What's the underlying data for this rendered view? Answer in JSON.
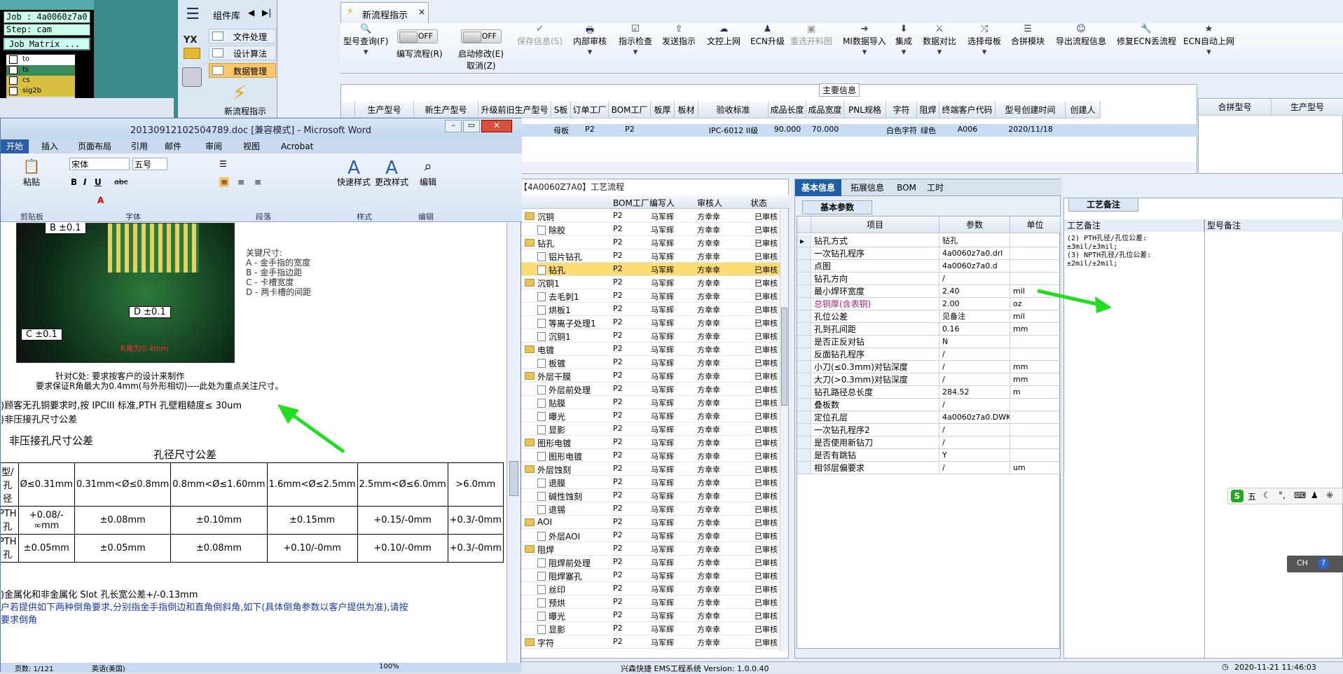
{
  "console": {
    "job": "Job : 4a0060z7a0",
    "step": "Step: cam",
    "matrix": "Job Matrix ...",
    "layers": [
      "to",
      "ts",
      "cs",
      "sig2b"
    ]
  },
  "nav": {
    "title": "组件库",
    "logo": "YX",
    "items": [
      "文件处理",
      "设计算法",
      "数据管理"
    ],
    "active": 2,
    "bottom": "新流程指示"
  },
  "tab": {
    "title": "新流程指示",
    "close": "×"
  },
  "toolbar": {
    "items": [
      "型号查询(F)",
      "编写流程(R)",
      "启动修改(E)",
      "保存信息(S)",
      "内部审核",
      "指示检查",
      "发送指示",
      "文控上网",
      "ECN升级",
      "重选开料图",
      "MI数据导入",
      "集成",
      "数据对比",
      "选择母板",
      "合拼模块",
      "导出流程信息",
      "修复ECN丢流程",
      "ECN自动上网"
    ],
    "cancel": "取消(Z)",
    "toggle_off": "OFF"
  },
  "main_info": {
    "title": "主要信息",
    "columns": [
      "生产型号",
      "新生产型号",
      "升级前旧生产型号",
      "S板",
      "订单工厂",
      "BOM工厂",
      "板厚",
      "板材",
      "验收标准",
      "成品长度",
      "成品宽度",
      "PNL规格",
      "字符",
      "阻焊",
      "终端客户代码",
      "型号创建时间",
      "创建人"
    ],
    "row": [
      "",
      "",
      "",
      "母板",
      "P2",
      "P2",
      "",
      "",
      "IPC-6012 II级",
      "90.000",
      "70.000",
      "",
      "白色字符",
      "绿色",
      "A006",
      "2020/11/18",
      ""
    ],
    "side_columns": [
      "合拼型号",
      "生产型号"
    ]
  },
  "word": {
    "title": "20130912102504789.doc [兼容模式] - Microsoft Word",
    "tabs": [
      "开始",
      "插入",
      "页面布局",
      "引用",
      "邮件",
      "审阅",
      "视图",
      "Acrobat"
    ],
    "font": "宋体",
    "size": "五号",
    "groups": [
      "剪贴板",
      "字体",
      "段落",
      "样式",
      "编辑"
    ],
    "big_buttons": [
      "粘贴",
      "快速样式",
      "更改样式",
      "编辑"
    ],
    "diagram_labels": [
      "B ±0.1",
      "D ±0.1",
      "C ±0.1",
      "R角为0.4mm"
    ],
    "key_dims": [
      "关键尺寸:",
      "A - 金手指的宽度",
      "B - 金手指边距",
      "C - 卡槽宽度",
      "D - 两卡槽的间距"
    ],
    "caption1": "针对C处: 要求按客户的设计来制作",
    "caption2": "要求保证R角最大为0.4mm(与外形相切)----此处为重点关注尺寸。",
    "line1": ")顾客无孔铜要求时,按 IPCIII 标准,PTH 孔壁粗糙度≤ 30um",
    "line2": ")非压接孔尺寸公差",
    "heading": "非压接孔尺寸公差",
    "table_title": "孔径尺寸公差",
    "table": [
      [
        "型/孔径",
        "Ø≤0.31mm",
        "0.31mm<Ø≤0.8mm",
        "0.8mm<Ø≤1.60mm",
        "1.6mm<Ø≤2.5mm",
        "2.5mm<Ø≤6.0mm",
        ">6.0mm"
      ],
      [
        "PTH孔",
        "+0.08/-∞mm",
        "±0.08mm",
        "±0.10mm",
        "±0.15mm",
        "+0.15/-0mm",
        "+0.3/-0mm"
      ],
      [
        "PTH孔",
        "±0.05mm",
        "±0.05mm",
        "±0.08mm",
        "+0.10/-0mm",
        "+0.10/-0mm",
        "+0.3/-0mm"
      ]
    ],
    "line3": ")金属化和非金属化 Slot 孔长宽公差+/-0.13mm",
    "line4": "户若提供如下两种倒角要求,分别指金手指倒边和直角倒斜角,如下(具体倒角参数以客户提供为准),请按",
    "line5": "要求倒角",
    "status": "页数: 1/121",
    "status2": "英语(美国)",
    "zoom": "100%"
  },
  "flow": {
    "title": "【4A0060Z7A0】工艺流程",
    "columns": [
      "BOM工厂",
      "编写人",
      "审核人",
      "状态"
    ],
    "rows": [
      {
        "n": "沉铜",
        "l": 0,
        "t": "f",
        "b": "P2",
        "w": "马军辉",
        "r": "方幸幸",
        "s": "已审核"
      },
      {
        "n": "除胶",
        "l": 1,
        "t": "d",
        "b": "P2",
        "w": "马军辉",
        "r": "方幸幸",
        "s": "已审核"
      },
      {
        "n": "钻孔",
        "l": 0,
        "t": "f",
        "b": "P2",
        "w": "马军辉",
        "r": "方幸幸",
        "s": "已审核"
      },
      {
        "n": "铝片钻孔",
        "l": 1,
        "t": "d",
        "b": "P2",
        "w": "马军辉",
        "r": "方幸幸",
        "s": "已审核"
      },
      {
        "n": "钻孔",
        "l": 1,
        "t": "d",
        "b": "P2",
        "w": "马军辉",
        "r": "方幸幸",
        "s": "已审核",
        "sel": true
      },
      {
        "n": "沉铜1",
        "l": 0,
        "t": "f",
        "b": "P2",
        "w": "马军辉",
        "r": "方幸幸",
        "s": "已审核"
      },
      {
        "n": "去毛刺1",
        "l": 1,
        "t": "d",
        "b": "P2",
        "w": "马军辉",
        "r": "方幸幸",
        "s": "已审核"
      },
      {
        "n": "烘板1",
        "l": 1,
        "t": "d",
        "b": "P2",
        "w": "马军辉",
        "r": "方幸幸",
        "s": "已审核"
      },
      {
        "n": "等离子处理1",
        "l": 1,
        "t": "d",
        "b": "P2",
        "w": "马军辉",
        "r": "方幸幸",
        "s": "已审核"
      },
      {
        "n": "沉铜1",
        "l": 1,
        "t": "d",
        "b": "P2",
        "w": "马军辉",
        "r": "方幸幸",
        "s": "已审核"
      },
      {
        "n": "电镀",
        "l": 0,
        "t": "f",
        "b": "P2",
        "w": "马军辉",
        "r": "方幸幸",
        "s": "已审核"
      },
      {
        "n": "板镀",
        "l": 1,
        "t": "d",
        "b": "P2",
        "w": "马军辉",
        "r": "方幸幸",
        "s": "已审核"
      },
      {
        "n": "外层干膜",
        "l": 0,
        "t": "f",
        "b": "P2",
        "w": "马军辉",
        "r": "方幸幸",
        "s": "已审核"
      },
      {
        "n": "外层前处理",
        "l": 1,
        "t": "d",
        "b": "P2",
        "w": "马军辉",
        "r": "方幸幸",
        "s": "已审核"
      },
      {
        "n": "贴膜",
        "l": 1,
        "t": "d",
        "b": "P2",
        "w": "马军辉",
        "r": "方幸幸",
        "s": "已审核"
      },
      {
        "n": "曝光",
        "l": 1,
        "t": "d",
        "b": "P2",
        "w": "马军辉",
        "r": "方幸幸",
        "s": "已审核"
      },
      {
        "n": "显影",
        "l": 1,
        "t": "d",
        "b": "P2",
        "w": "马军辉",
        "r": "方幸幸",
        "s": "已审核"
      },
      {
        "n": "图形电镀",
        "l": 0,
        "t": "f",
        "b": "P2",
        "w": "马军辉",
        "r": "方幸幸",
        "s": "已审核"
      },
      {
        "n": "图形电镀",
        "l": 1,
        "t": "d",
        "b": "P2",
        "w": "马军辉",
        "r": "方幸幸",
        "s": "已审核"
      },
      {
        "n": "外层蚀刻",
        "l": 0,
        "t": "f",
        "b": "P2",
        "w": "马军辉",
        "r": "方幸幸",
        "s": "已审核"
      },
      {
        "n": "退膜",
        "l": 1,
        "t": "d",
        "b": "P2",
        "w": "马军辉",
        "r": "方幸幸",
        "s": "已审核"
      },
      {
        "n": "碱性蚀刻",
        "l": 1,
        "t": "d",
        "b": "P2",
        "w": "马军辉",
        "r": "方幸幸",
        "s": "已审核"
      },
      {
        "n": "退锡",
        "l": 1,
        "t": "d",
        "b": "P2",
        "w": "马军辉",
        "r": "方幸幸",
        "s": "已审核"
      },
      {
        "n": "AOI",
        "l": 0,
        "t": "f",
        "b": "P2",
        "w": "马军辉",
        "r": "方幸幸",
        "s": "已审核"
      },
      {
        "n": "外层AOI",
        "l": 1,
        "t": "d",
        "b": "P2",
        "w": "马军辉",
        "r": "方幸幸",
        "s": "已审核"
      },
      {
        "n": "阻焊",
        "l": 0,
        "t": "f",
        "b": "P2",
        "w": "马军辉",
        "r": "方幸幸",
        "s": "已审核"
      },
      {
        "n": "阻焊前处理",
        "l": 1,
        "t": "d",
        "b": "P2",
        "w": "马军辉",
        "r": "方幸幸",
        "s": "已审核"
      },
      {
        "n": "阻焊塞孔",
        "l": 1,
        "t": "d",
        "b": "P2",
        "w": "马军辉",
        "r": "方幸幸",
        "s": "已审核"
      },
      {
        "n": "丝印",
        "l": 1,
        "t": "d",
        "b": "P2",
        "w": "马军辉",
        "r": "方幸幸",
        "s": "已审核"
      },
      {
        "n": "预烘",
        "l": 1,
        "t": "d",
        "b": "P2",
        "w": "马军辉",
        "r": "方幸幸",
        "s": "已审核"
      },
      {
        "n": "曝光",
        "l": 1,
        "t": "d",
        "b": "P2",
        "w": "马军辉",
        "r": "方幸幸",
        "s": "已审核"
      },
      {
        "n": "显影",
        "l": 1,
        "t": "d",
        "b": "P2",
        "w": "马军辉",
        "r": "方幸幸",
        "s": "已审核"
      },
      {
        "n": "字符",
        "l": 0,
        "t": "f",
        "b": "P2",
        "w": "马军辉",
        "r": "方幸幸",
        "s": "已审核"
      }
    ]
  },
  "detail": {
    "tabs": [
      "基本信息",
      "拓展信息",
      "BOM",
      "工时"
    ],
    "sub_tab": "基本参数",
    "columns": [
      "项目",
      "参数",
      "单位"
    ],
    "rows": [
      {
        "k": "钻孔方式",
        "v": "钻孔",
        "u": ""
      },
      {
        "k": "一次钻孔程序",
        "v": "4a0060z7a0.drl",
        "u": ""
      },
      {
        "k": "点图",
        "v": "4a0060z7a0.d",
        "u": ""
      },
      {
        "k": "钻孔方向",
        "v": "/",
        "u": ""
      },
      {
        "k": "最小焊环宽度",
        "v": "2.40",
        "u": "mil"
      },
      {
        "k": "总铜厚(含表铜)",
        "v": "2.00",
        "u": "oz",
        "c": "#a0206a"
      },
      {
        "k": "孔位公差",
        "v": "见备注",
        "u": "mil"
      },
      {
        "k": "孔到孔间距",
        "v": "0.16",
        "u": "mm"
      },
      {
        "k": "是否正反对钻",
        "v": "N",
        "u": ""
      },
      {
        "k": "反面钻孔程序",
        "v": "/",
        "u": ""
      },
      {
        "k": "小刀(≤0.3mm)对钻深度",
        "v": "/",
        "u": "mm"
      },
      {
        "k": "大刀(>0.3mm)对钻深度",
        "v": "/",
        "u": "mm"
      },
      {
        "k": "钻孔路径总长度",
        "v": "284.52",
        "u": "m"
      },
      {
        "k": "叠板数",
        "v": "/",
        "u": ""
      },
      {
        "k": "定位孔层",
        "v": "4a0060z7a0.DWK",
        "u": ""
      },
      {
        "k": "一次钻孔程序2",
        "v": "/",
        "u": ""
      },
      {
        "k": "是否使用新钻刀",
        "v": "/",
        "u": ""
      },
      {
        "k": "是否有跳钻",
        "v": "Y",
        "u": ""
      },
      {
        "k": "相邻层偏要求",
        "v": "/",
        "u": "um"
      }
    ]
  },
  "notes": {
    "title": "工艺备注",
    "col1": "工艺备注",
    "col2": "型号备注",
    "lines": [
      "(2) PTH孔径/孔位公差:",
      "±3mil/±3mil;",
      "(3) NPTH孔径/孔位公差:",
      "±2mil/±2mil;"
    ]
  },
  "ime": {
    "items": [
      "五"
    ]
  },
  "ime2": {
    "label": "CH"
  },
  "status": {
    "center": "兴森快捷 EMS工程系统 Version: 1.0.0.40",
    "right": "2020-11-21 11:46:03"
  },
  "colors": {
    "accent": "#1e5fa8",
    "selected": "#fddc74",
    "arrow": "#22dd22"
  }
}
